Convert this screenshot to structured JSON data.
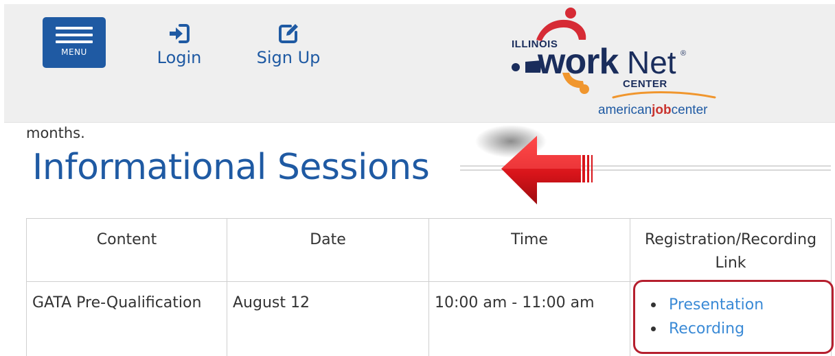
{
  "header": {
    "menu_label": "MENU",
    "login_label": "Login",
    "signup_label": "Sign Up",
    "logo": {
      "illinois": "ILLINOIS",
      "work": "work",
      "net": "Net",
      "registered": "®",
      "center": "CENTER",
      "ajc_prefix": "american",
      "ajc_job": "job",
      "ajc_suffix": "center"
    }
  },
  "content": {
    "fragment_text": "months.",
    "section_title": "Informational Sessions"
  },
  "table": {
    "headers": [
      "Content",
      "Date",
      "Time",
      "Registration/Recording Link"
    ],
    "rows": [
      {
        "content": "GATA Pre-Qualification",
        "date": "August 12",
        "time": "10:00 am - 11:00 am",
        "links": [
          "Presentation",
          "Recording"
        ]
      }
    ]
  },
  "colors": {
    "brand_blue": "#1f5aa3",
    "link_blue": "#3a8ad6",
    "annotation_red": "#b51f2e",
    "logo_navy": "#1a2d5c",
    "logo_orange": "#f0962e",
    "logo_red": "#d62b35"
  },
  "icons": {
    "menu": "hamburger-icon",
    "login": "sign-in-icon",
    "signup": "edit-icon"
  }
}
